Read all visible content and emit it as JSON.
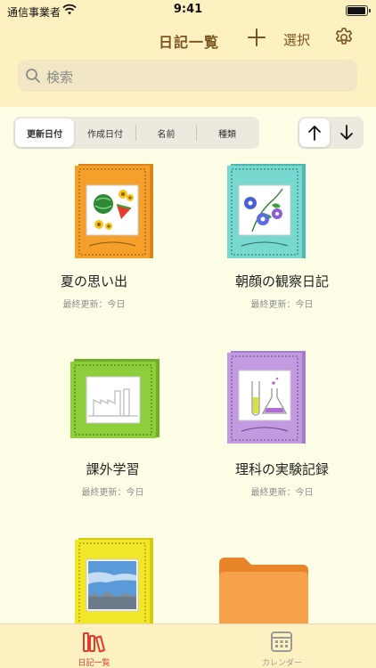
{
  "status_bar": {
    "carrier": "通信事業者",
    "time": "9:41"
  },
  "nav": {
    "title": "日記一覧",
    "select_label": "選択"
  },
  "search": {
    "placeholder": "検索"
  },
  "sort": {
    "options": [
      "更新日付",
      "作成日付",
      "名前",
      "種類"
    ],
    "selected": "更新日付"
  },
  "order": {
    "selected": "ascending"
  },
  "diaries": [
    {
      "title": "夏の思い出",
      "updated": "最終更新：今日",
      "cover_color": "#f5a02a",
      "icon": "summer-fruit-cover-icon"
    },
    {
      "title": "朝顔の観察日記",
      "updated": "最終更新：今日",
      "cover_color": "#76d8cf",
      "icon": "morning-glory-cover-icon"
    },
    {
      "title": "課外学習",
      "updated": "最終更新：今日",
      "cover_color": "#8ccf3a",
      "icon": "factory-cover-icon"
    },
    {
      "title": "理科の実験記録",
      "updated": "最終更新：今日",
      "cover_color": "#c29ae0",
      "icon": "lab-flask-cover-icon"
    },
    {
      "title": "",
      "updated": "",
      "cover_color": "#f2e628",
      "icon": "sky-photo-cover-icon"
    },
    {
      "title": "",
      "updated": "",
      "cover_color": "#f0a14a",
      "icon": "folder-icon"
    }
  ],
  "tabs": [
    {
      "label": "日記一覧",
      "active": true,
      "icon": "bookshelf-icon"
    },
    {
      "label": "カレンダー",
      "active": false,
      "icon": "calendar-icon"
    }
  ],
  "colors": {
    "accent": "#e03a2f",
    "nav_text": "#7a5520",
    "background": "#fefde6",
    "bar": "#fdf0c1"
  }
}
